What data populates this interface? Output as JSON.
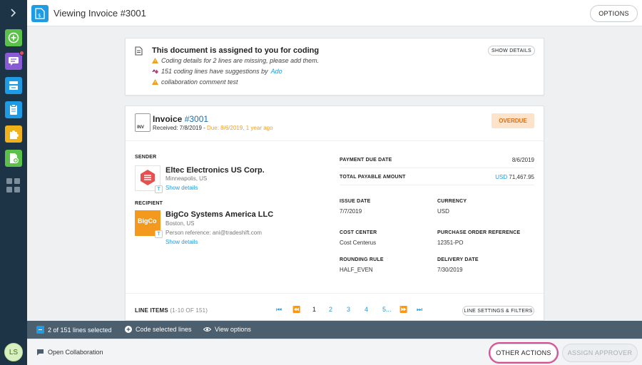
{
  "header": {
    "title": "Viewing Invoice #3001",
    "options_label": "OPTIONS"
  },
  "rail": {
    "user_initials": "LS"
  },
  "notice": {
    "heading": "This document is assigned to you for coding",
    "messages": [
      {
        "text": "Coding details for 2 lines are missing, please add them.",
        "icon": "warning-icon"
      },
      {
        "text": "151 coding lines have suggestions by ",
        "link": "Ado",
        "icon": "ado-icon"
      },
      {
        "text": "collaboration comment test",
        "icon": "warning-icon"
      }
    ],
    "show_details": "SHOW DETAILS"
  },
  "invoice": {
    "icon_label": "INV",
    "title": "Invoice ",
    "number": "#3001",
    "received": "Received: 7/8/2019 - ",
    "due": "Due: 8/6/2019, 1 year ago",
    "status": "OVERDUE",
    "sender": {
      "label": "SENDER",
      "name": "Eltec Electronics US Corp.",
      "location": "Minneapolis, US",
      "show_details": "Show details",
      "logo_text": "ELTEC"
    },
    "recipient": {
      "label": "RECIPIENT",
      "name": "BigCo Systems America LLC",
      "location": "Boston, US",
      "person": "Person reference: ani@tradeshift.com",
      "show_details": "Show details",
      "logo_text": "BigCo"
    },
    "payment_due_label": "PAYMENT DUE DATE",
    "payment_due_value": "8/6/2019",
    "total_label": "TOTAL PAYABLE AMOUNT",
    "total_currency": "USD",
    "total_value": "71,467.95",
    "issue_date_label": "ISSUE DATE",
    "issue_date_value": "7/7/2019",
    "currency_label": "CURRENCY",
    "currency_value": "USD",
    "cost_center_label": "COST CENTER",
    "cost_center_value": "Cost Centerus",
    "po_label": "PURCHASE ORDER REFERENCE",
    "po_value": "12351-PO",
    "rounding_label": "ROUNDING RULE",
    "rounding_value": "HALF_EVEN",
    "delivery_label": "DELIVERY DATE",
    "delivery_value": "7/30/2019",
    "line_items_label": "LINE ITEMS",
    "line_items_range": "(1-10 OF 151)",
    "pages": [
      "1",
      "2",
      "3",
      "4",
      "5..."
    ],
    "line_settings": "LINE SETTINGS & FILTERS"
  },
  "selection_bar": {
    "selected": "2 of 151 lines selected",
    "code_selected": "Code selected lines",
    "view_options": "View options"
  },
  "footer": {
    "open_collab": "Open Collaboration",
    "other_actions": "OTHER ACTIONS",
    "assign_approver": "ASSIGN APPROVER"
  },
  "colors": {
    "rail": "#1d3447",
    "accent": "#1e9be5",
    "overdue_bg": "#fde3c9",
    "overdue_text": "#d66e18",
    "highlight": "#d94d95"
  }
}
